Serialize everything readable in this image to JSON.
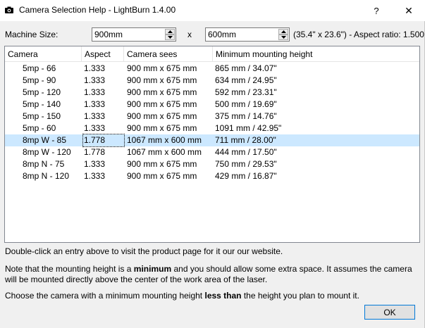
{
  "window": {
    "title": "Camera Selection Help - LightBurn 1.4.00",
    "help_glyph": "?",
    "close_glyph": "✕"
  },
  "machine": {
    "label": "Machine Size:",
    "width": "900mm",
    "height": "600mm",
    "separator": "x",
    "info": "(35.4\" x 23.6\") - Aspect ratio: 1.500"
  },
  "table": {
    "headers": [
      "Camera",
      "Aspect",
      "Camera sees",
      "Minimum mounting height"
    ],
    "rows": [
      {
        "camera": "5mp - 66",
        "aspect": "1.333",
        "sees": "900 mm x 675 mm",
        "height": "865 mm / 34.07\""
      },
      {
        "camera": "5mp - 90",
        "aspect": "1.333",
        "sees": "900 mm x 675 mm",
        "height": "634 mm / 24.95\""
      },
      {
        "camera": "5mp - 120",
        "aspect": "1.333",
        "sees": "900 mm x 675 mm",
        "height": "592 mm / 23.31\""
      },
      {
        "camera": "5mp - 140",
        "aspect": "1.333",
        "sees": "900 mm x 675 mm",
        "height": "500 mm / 19.69\""
      },
      {
        "camera": "5mp - 150",
        "aspect": "1.333",
        "sees": "900 mm x 675 mm",
        "height": "375 mm / 14.76\""
      },
      {
        "camera": "5mp - 60",
        "aspect": "1.333",
        "sees": "900 mm x 675 mm",
        "height": "1091 mm / 42.95\""
      },
      {
        "camera": "8mp W - 85",
        "aspect": "1.778",
        "sees": "1067 mm x 600 mm",
        "height": "711 mm / 28.00\""
      },
      {
        "camera": "8mp W - 120",
        "aspect": "1.778",
        "sees": "1067 mm x 600 mm",
        "height": "444 mm / 17.50\""
      },
      {
        "camera": "8mp N - 75",
        "aspect": "1.333",
        "sees": "900 mm x 675 mm",
        "height": "750 mm / 29.53\""
      },
      {
        "camera": "8mp N - 120",
        "aspect": "1.333",
        "sees": "900 mm x 675 mm",
        "height": "429 mm / 16.87\""
      }
    ],
    "selected_index": 6
  },
  "help": {
    "line1": "Double-click an entry above to visit the product page for it our our website.",
    "line2_pre": "Note that the mounting height is a ",
    "line2_bold": "minimum",
    "line2_post": " and you should allow some extra space. It assumes the camera will be mounted directly above the center of the work area of the laser.",
    "line3_pre": "Choose the camera with a minimum mounting height ",
    "line3_bold": "less than",
    "line3_post": " the height you plan to mount it."
  },
  "ok_label": "OK",
  "colors": {
    "selected_row": "#cce8ff",
    "focus_border": "#0078d7"
  }
}
